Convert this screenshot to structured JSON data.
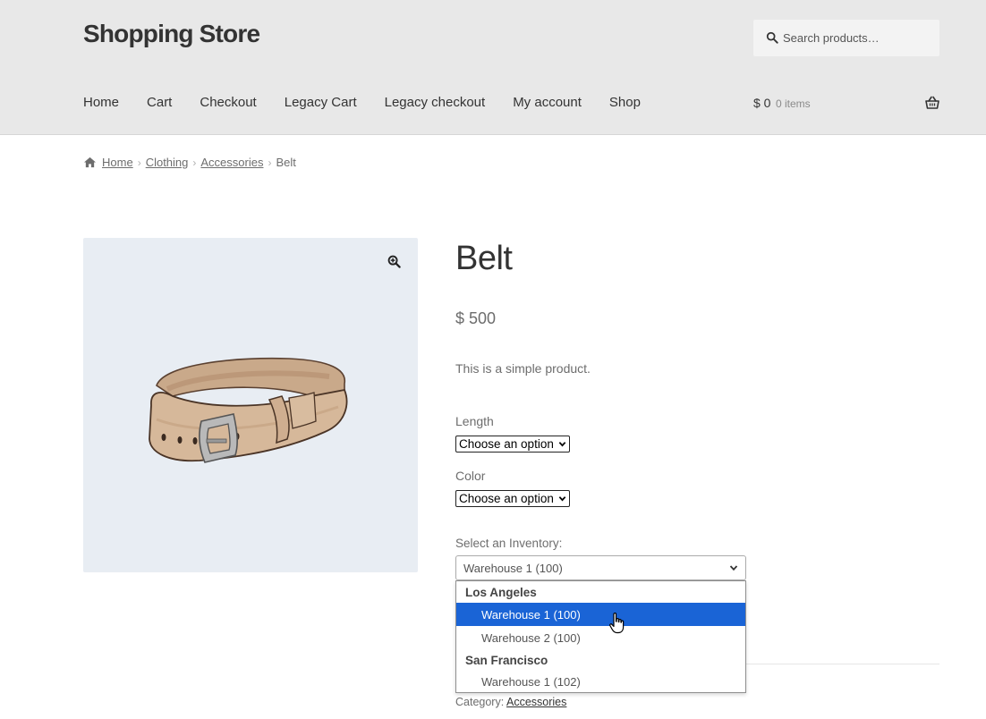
{
  "header": {
    "site_title": "Shopping Store",
    "search_placeholder": "Search products…",
    "nav": [
      "Home",
      "Cart",
      "Checkout",
      "Legacy Cart",
      "Legacy checkout",
      "My account",
      "Shop"
    ],
    "cart_amount": "$ 0",
    "cart_count": "0 items"
  },
  "breadcrumb": {
    "items": [
      "Home",
      "Clothing",
      "Accessories"
    ],
    "current": "Belt"
  },
  "product": {
    "title": "Belt",
    "price": "$ 500",
    "description": "This is a simple product.",
    "length_label": "Length",
    "length_value": "Choose an option",
    "color_label": "Color",
    "color_value": "Choose an option",
    "inventory_label": "Select an Inventory:",
    "inventory_value": "Warehouse 1 (100)",
    "category_prefix": "Category:",
    "category_link": "Accessories"
  },
  "inventory_dropdown": {
    "groups": [
      {
        "label": "Los Angeles",
        "options": [
          "Warehouse 1 (100)",
          "Warehouse 2 (100)"
        ]
      },
      {
        "label": "San Francisco",
        "options": [
          "Warehouse 1 (102)"
        ]
      }
    ],
    "highlighted": "Warehouse 1 (100)"
  },
  "colors": {
    "header_bg": "#e8e8e8",
    "image_bg": "#e8edf3",
    "highlight": "#1a64d6",
    "text_dark": "#333333",
    "text_muted": "#6d6d6d"
  },
  "icons": {
    "search": "search-icon",
    "basket": "basket-icon",
    "home": "home-icon",
    "zoom": "zoom-icon",
    "cursor": "hand-cursor-icon"
  }
}
